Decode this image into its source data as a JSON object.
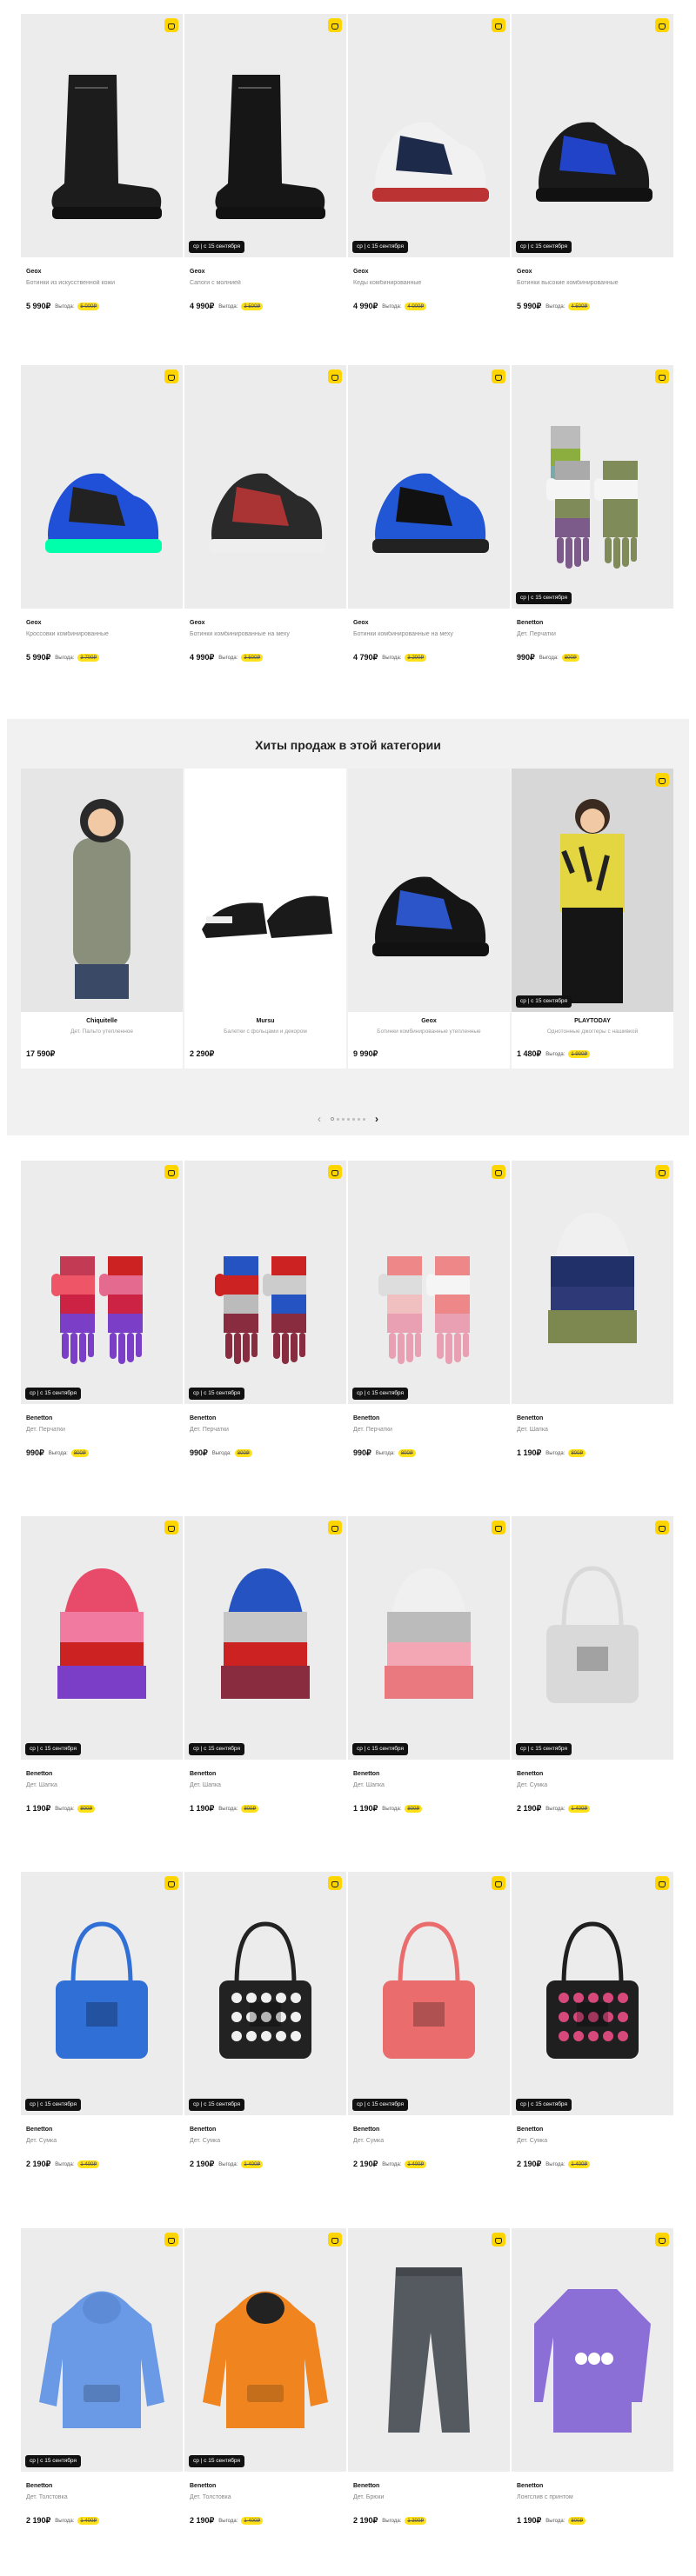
{
  "delivery_label": "ср | с 15 сентября",
  "savings_label": "Выгода:",
  "row1": [
    {
      "brand": "Geox",
      "name": "Ботинки из искусственной кожи",
      "price": "5 990₽",
      "discount": "5 000₽",
      "delivery": false
    },
    {
      "brand": "Geox",
      "name": "Сапоги с молнией",
      "price": "4 990₽",
      "discount": "3 500₽",
      "delivery": true
    },
    {
      "brand": "Geox",
      "name": "Кеды комбинированные",
      "price": "4 990₽",
      "discount": "4 000₽",
      "delivery": true
    },
    {
      "brand": "Geox",
      "name": "Ботинки высокие комбинированные",
      "price": "5 990₽",
      "discount": "4 500₽",
      "delivery": true
    }
  ],
  "row2": [
    {
      "brand": "Geox",
      "name": "Кроссовки комбинированные",
      "price": "5 990₽",
      "discount": "3 700₽",
      "delivery": false
    },
    {
      "brand": "Geox",
      "name": "Ботинки комбинированные на меху",
      "price": "4 990₽",
      "discount": "3 500₽",
      "delivery": false
    },
    {
      "brand": "Geox",
      "name": "Ботинки комбинированные на меху",
      "price": "4 790₽",
      "discount": "3 200₽",
      "delivery": false
    },
    {
      "brand": "Benetton",
      "name": "Дет. Перчатки",
      "price": "990₽",
      "discount": "800₽",
      "delivery": true
    }
  ],
  "hits": {
    "title": "Хиты продаж в этой категории",
    "items": [
      {
        "brand": "Chiquitelle",
        "name": "Дет. Пальто утепленное",
        "price": "17 590₽",
        "discount": "",
        "delivery": false
      },
      {
        "brand": "Mursu",
        "name": "Балетки с фольцами и декором",
        "price": "2 290₽",
        "discount": "",
        "delivery": false
      },
      {
        "brand": "Geox",
        "name": "Ботинки комбинированные утепленные",
        "price": "9 990₽",
        "discount": "",
        "delivery": false
      },
      {
        "brand": "PLAYTODAY",
        "name": "Однотонные джоггеры с нашивкой",
        "price": "1 480₽",
        "discount": "1 900₽",
        "delivery": true
      }
    ]
  },
  "row3": [
    {
      "brand": "Benetton",
      "name": "Дет. Перчатки",
      "price": "990₽",
      "discount": "800₽",
      "delivery": true
    },
    {
      "brand": "Benetton",
      "name": "Дет. Перчатки",
      "price": "990₽",
      "discount": "800₽",
      "delivery": true
    },
    {
      "brand": "Benetton",
      "name": "Дет. Перчатки",
      "price": "990₽",
      "discount": "800₽",
      "delivery": true
    },
    {
      "brand": "Benetton",
      "name": "Дет. Шапка",
      "price": "1 190₽",
      "discount": "800₽",
      "delivery": false
    }
  ],
  "row4": [
    {
      "brand": "Benetton",
      "name": "Дет. Шапка",
      "price": "1 190₽",
      "discount": "800₽",
      "delivery": true
    },
    {
      "brand": "Benetton",
      "name": "Дет. Шапка",
      "price": "1 190₽",
      "discount": "800₽",
      "delivery": true
    },
    {
      "brand": "Benetton",
      "name": "Дет. Шапка",
      "price": "1 190₽",
      "discount": "800₽",
      "delivery": true
    },
    {
      "brand": "Benetton",
      "name": "Дет. Сумка",
      "price": "2 190₽",
      "discount": "1 400₽",
      "delivery": true
    }
  ],
  "row5": [
    {
      "brand": "Benetton",
      "name": "Дет. Сумка",
      "price": "2 190₽",
      "discount": "1 400₽",
      "delivery": true
    },
    {
      "brand": "Benetton",
      "name": "Дет. Сумка",
      "price": "2 190₽",
      "discount": "1 400₽",
      "delivery": true
    },
    {
      "brand": "Benetton",
      "name": "Дет. Сумка",
      "price": "2 190₽",
      "discount": "1 400₽",
      "delivery": true
    },
    {
      "brand": "Benetton",
      "name": "Дет. Сумка",
      "price": "2 190₽",
      "discount": "1 400₽",
      "delivery": true
    }
  ],
  "row6": [
    {
      "brand": "Benetton",
      "name": "Дет. Толстовка",
      "price": "2 190₽",
      "discount": "1 400₽",
      "delivery": true
    },
    {
      "brand": "Benetton",
      "name": "Дет. Толстовка",
      "price": "2 190₽",
      "discount": "1 400₽",
      "delivery": true
    },
    {
      "brand": "Benetton",
      "name": "Дет. Брюки",
      "price": "2 190₽",
      "discount": "1 300₽",
      "delivery": false
    },
    {
      "brand": "Benetton",
      "name": "Лонгслив с принтом",
      "price": "1 190₽",
      "discount": "800₽",
      "delivery": false
    }
  ],
  "colors": {
    "accent": "#ffd500",
    "tag": "#111111"
  }
}
